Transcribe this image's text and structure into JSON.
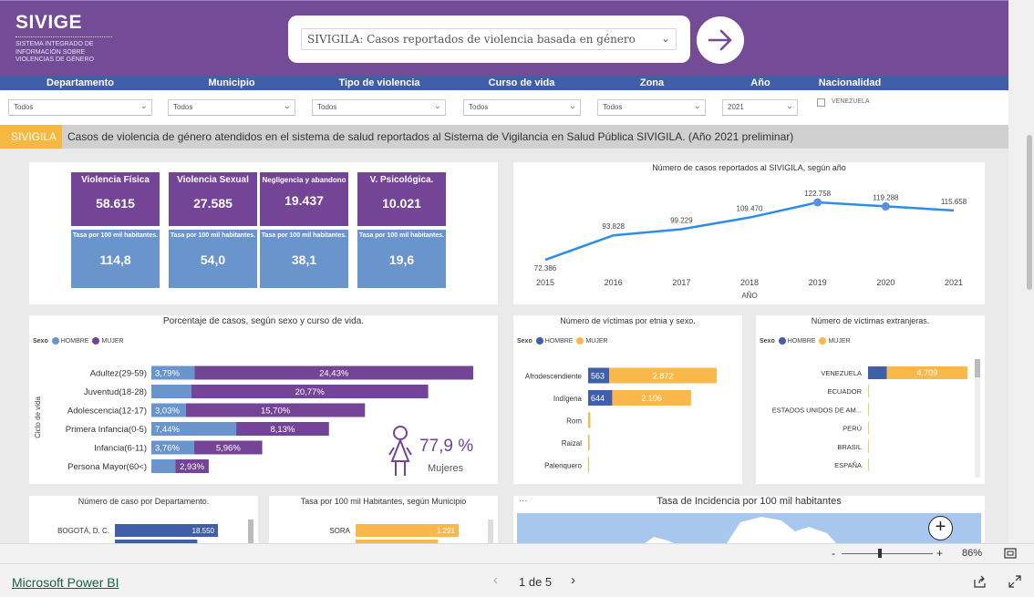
{
  "header": {
    "logo_title": "SIVIGE",
    "logo_subtitle": "SISTEMA INTEGRADO DE INFORMACIÓN SOBRE VIOLENCIAS DE GÉNERO",
    "report_select": "SIVIGILA: Casos reportados de violencia basada en género"
  },
  "filters": [
    {
      "label": "Departamento",
      "value": "Todos"
    },
    {
      "label": "Municipio",
      "value": "Todos"
    },
    {
      "label": "Tipo de violencia",
      "value": "Todos"
    },
    {
      "label": "Curso de vida",
      "value": "Todos"
    },
    {
      "label": "Zona",
      "value": "Todos"
    },
    {
      "label": "Año",
      "value": "2021"
    },
    {
      "label": "Nacionalidad",
      "value": "VENEZUELA"
    }
  ],
  "banner": {
    "tag": "SIVIGILA",
    "text": "Casos de violencia de género atendidos en el sistema de salud reportados al Sistema de Vigilancia en Salud Pública SIVIGILA. (Año 2021 preliminar)"
  },
  "kpis": [
    {
      "label": "Violencia Física",
      "value": "58.615",
      "rate_label": "Tasa por 100 mil habitantes.",
      "rate": "114,8"
    },
    {
      "label": "Violencia Sexual",
      "value": "27.585",
      "rate_label": "Tasa por 100 mil habitantes.",
      "rate": "54,0"
    },
    {
      "label": "Negligencia y abandono",
      "value": "19.437",
      "rate_label": "Tasa por 100 mil habitantes.",
      "rate": "38,1"
    },
    {
      "label": "V. Psicológica.",
      "value": "10.021",
      "rate_label": "Tasa por 100 mil habitantes.",
      "rate": "19,6"
    }
  ],
  "women": {
    "pct": "77,9 %",
    "label": "Mujeres"
  },
  "legend": {
    "sexo": "Sexo",
    "hombre": "HOMBRE",
    "mujer": "MUJER"
  },
  "chart_data": [
    {
      "type": "line",
      "title": "Número de casos reportados al SIVIGILA, según año",
      "xlabel": "AÑO",
      "x": [
        "2015",
        "2016",
        "2017",
        "2018",
        "2019",
        "2020",
        "2021"
      ],
      "labels": [
        "72.386",
        "93.828",
        "99.229",
        "109.470",
        "122.758",
        "119.288",
        "115.658"
      ],
      "values": [
        72386,
        93828,
        99229,
        109470,
        122758,
        119288,
        115658
      ]
    },
    {
      "type": "bar",
      "title": "Porcentaje de casos, según sexo y curso de vida.",
      "ylabel": "Ciclo de vida",
      "categories": [
        "Adultez(29-59)",
        "Juventud(18-28)",
        "Adolescencia(12-17)",
        "Primera Infancia(0-5)",
        "Infancia(6-11)",
        "Persona Mayor(60<)"
      ],
      "series": [
        {
          "name": "HOMBRE",
          "values": [
            3.79,
            3.5,
            3.03,
            7.44,
            3.76,
            2.1
          ],
          "labels": [
            "3,79%",
            "",
            "3,03%",
            "7,44%",
            "3,76%",
            ""
          ]
        },
        {
          "name": "MUJER",
          "values": [
            24.43,
            20.77,
            15.7,
            8.13,
            5.96,
            2.93
          ],
          "labels": [
            "24,43%",
            "20,77%",
            "15,70%",
            "8,13%",
            "5,96%",
            "2,93%"
          ]
        }
      ]
    },
    {
      "type": "bar",
      "title": "Número de víctimas por etnia y sexo.",
      "categories": [
        "Afrodescendiente",
        "Indígena",
        "Rom",
        "Raizal",
        "Palenquero"
      ],
      "series": [
        {
          "name": "HOMBRE",
          "values": [
            563,
            644,
            0,
            0,
            0
          ],
          "labels": [
            "563",
            "644",
            "",
            "",
            ""
          ]
        },
        {
          "name": "MUJER",
          "values": [
            2872,
            2106,
            60,
            40,
            10
          ],
          "labels": [
            "2.872",
            "2.106",
            "",
            "",
            ""
          ]
        }
      ]
    },
    {
      "type": "bar",
      "title": "Número de víctimas extranjeras.",
      "categories": [
        "VENEZUELA",
        "ECUADOR",
        "ESTADOS UNIDOS DE AM...",
        "PERÚ",
        "BRASIL",
        "ESPAÑA"
      ],
      "series": [
        {
          "name": "HOMBRE",
          "values": [
            1100,
            0,
            0,
            0,
            0,
            0
          ],
          "labels": [
            "",
            "",
            "",
            "",
            "",
            ""
          ]
        },
        {
          "name": "MUJER",
          "values": [
            4709,
            15,
            5,
            3,
            2,
            1
          ],
          "labels": [
            "4.709",
            "",
            "",
            "",
            "",
            ""
          ]
        }
      ]
    },
    {
      "type": "bar",
      "title": "Número de caso por Departamento.",
      "categories": [
        "BOGOTÁ, D. C."
      ],
      "values": [
        18550
      ],
      "labels": [
        "18.550"
      ]
    },
    {
      "type": "bar",
      "title": "Tasa por 100 mil Habitantes, según Municipio",
      "categories": [
        "SORA"
      ],
      "values": [
        1291
      ],
      "labels": [
        "1.291"
      ]
    }
  ],
  "map": {
    "title": "Tasa de Incidencia por 100 mil habitantes"
  },
  "zoom": {
    "level": "86%",
    "minus": "-",
    "plus": "+"
  },
  "footer": {
    "brand": "Microsoft Power BI",
    "page": "1 de 5"
  },
  "colors": {
    "purple": "#744497",
    "blue": "#6a94cc",
    "hombre": "#3f5fa8",
    "mujer": "#f9b94a",
    "line": "#2e8ee6"
  }
}
